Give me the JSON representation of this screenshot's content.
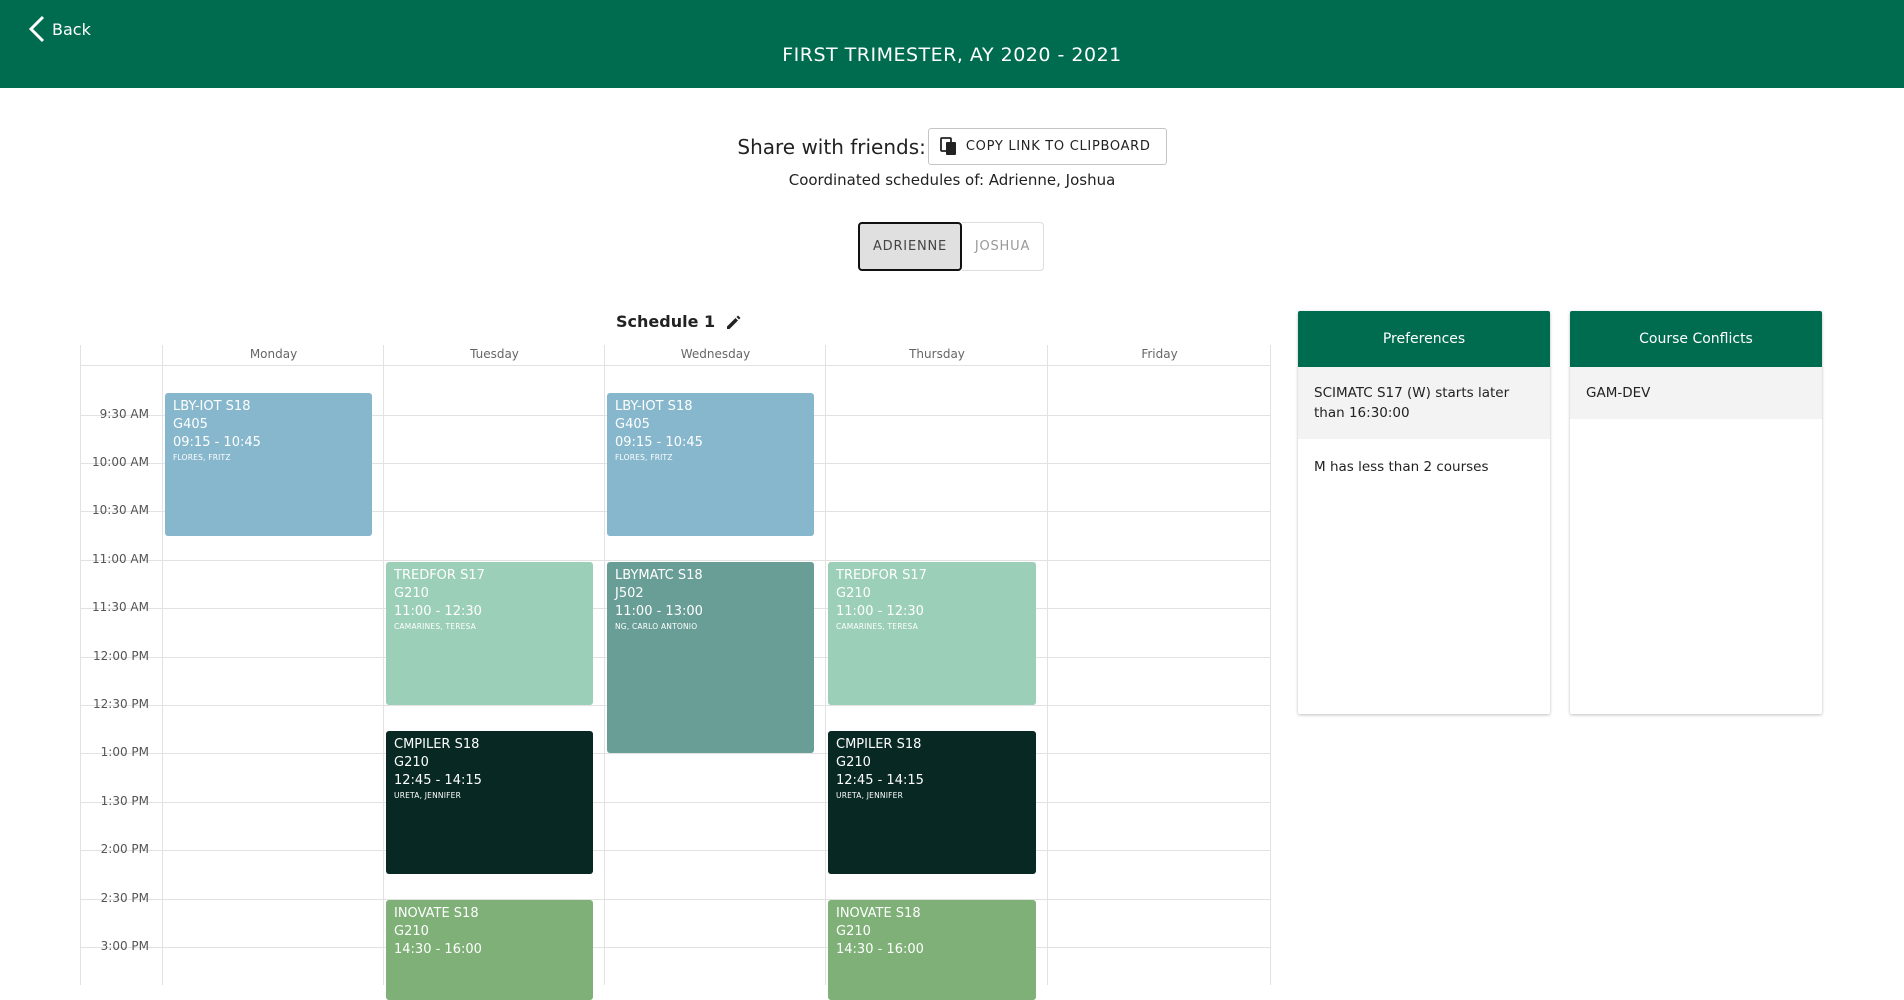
{
  "header": {
    "back_label": "Back",
    "title": "FIRST TRIMESTER, AY 2020 - 2021"
  },
  "share": {
    "label": "Share with friends:",
    "copy_button": "COPY LINK TO CLIPBOARD"
  },
  "coordinated": "Coordinated schedules of: Adrienne, Joshua",
  "toggle": {
    "active": "ADRIENNE",
    "inactive": "JOSHUA"
  },
  "schedule": {
    "title": "Schedule 1"
  },
  "days": [
    "Monday",
    "Tuesday",
    "Wednesday",
    "Thursday",
    "Friday"
  ],
  "times": [
    "9:30 AM",
    "10:00 AM",
    "10:30 AM",
    "11:00 AM",
    "11:30 AM",
    "12:00 PM",
    "12:30 PM",
    "1:00 PM",
    "1:30 PM",
    "2:00 PM",
    "2:30 PM",
    "3:00 PM"
  ],
  "events": [
    {
      "course": "LBY-IOT S18",
      "room": "G405",
      "time": "09:15 - 10:45",
      "instructor": "FLORES, FRITZ"
    },
    {
      "course": "LBY-IOT S18",
      "room": "G405",
      "time": "09:15 - 10:45",
      "instructor": "FLORES, FRITZ"
    },
    {
      "course": "TREDFOR S17",
      "room": "G210",
      "time": "11:00 - 12:30",
      "instructor": "CAMARINES, TERESA"
    },
    {
      "course": "LBYMATC S18",
      "room": "J502",
      "time": "11:00 - 13:00",
      "instructor": "NG, CARLO ANTONIO"
    },
    {
      "course": "TREDFOR S17",
      "room": "G210",
      "time": "11:00 - 12:30",
      "instructor": "CAMARINES, TERESA"
    },
    {
      "course": "CMPILER S18",
      "room": "G210",
      "time": "12:45 - 14:15",
      "instructor": "URETA, JENNIFER"
    },
    {
      "course": "CMPILER S18",
      "room": "G210",
      "time": "12:45 - 14:15",
      "instructor": "URETA, JENNIFER"
    },
    {
      "course": "INOVATE S18",
      "room": "G210",
      "time": "14:30 - 16:00",
      "instructor": ""
    },
    {
      "course": "INOVATE S18",
      "room": "G210",
      "time": "14:30 - 16:00",
      "instructor": ""
    }
  ],
  "preferences": {
    "title": "Preferences",
    "items": [
      "SCIMATC S17 (W) starts later than 16:30:00",
      "M has less than 2 courses"
    ]
  },
  "conflicts": {
    "title": "Course Conflicts",
    "items": [
      "GAM-DEV"
    ]
  },
  "colors": {
    "brand": "#006C4F",
    "blue": "#87B7CC",
    "mint": "#9BCFB7",
    "teal": "#699E96",
    "dark": "#082823",
    "green": "#7EB077"
  }
}
